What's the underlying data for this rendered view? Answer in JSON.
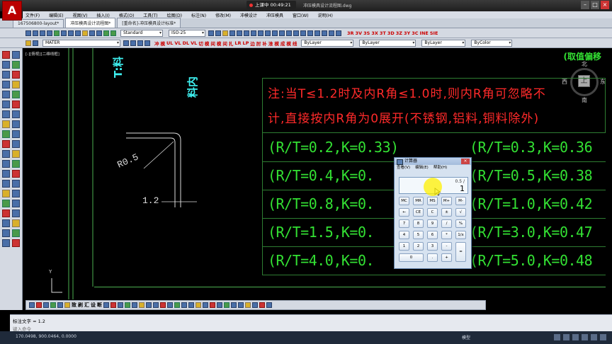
{
  "app": {
    "recording": "上课中 00:49:21",
    "doc_title": "冲压模具设计流程图.dwg"
  },
  "menu": [
    "文件(F)",
    "编辑(E)",
    "视图(V)",
    "插入(I)",
    "格式(O)",
    "工具(T)",
    "绘图(D)",
    "标注(N)",
    "修改(M)",
    "冲模设计",
    "冲压模具",
    "窗口(W)",
    "说明(H)"
  ],
  "tabs": [
    "167506800-layout*",
    "冲压模具设计流程图*",
    "[重命名]-冲压模具设计标准*"
  ],
  "toolbar": {
    "text_style": "Standard",
    "dim_style": "ISO-25",
    "layer": "MATER",
    "color": "ByLayer",
    "linetype": "ByLayer",
    "lineweight": "ByLayer",
    "plotstyle": "ByColor",
    "red_cmds1": [
      "3R",
      "3V",
      "3S",
      "3X",
      "3T",
      "3D",
      "3Z",
      "3Y",
      "3C",
      "INE",
      "SIE"
    ],
    "red_cmds2": [
      "冲",
      "模",
      "UL",
      "VL",
      "DL",
      "VL",
      "切",
      "模",
      "间",
      "模",
      "间",
      "扎",
      "LR",
      "LP",
      "边",
      "肘",
      "补",
      "淮",
      "模",
      "成",
      "模",
      "线"
    ]
  },
  "canvas": {
    "view_label": "[-][俯视][二维线框]",
    "hint": "(取值偏移",
    "left_text1": "T:料",
    "left_text2": "料内",
    "dim_radius": "R0.5",
    "dim_thickness": "1.2",
    "compass": {
      "north": "北",
      "south": "南",
      "east": "东",
      "west": "西",
      "center": "上"
    },
    "note_line1": "注:当T≤1.2时及内R角≤1.0时,则内R角可忽略不",
    "note_line2": "计,直接按内R角为0展开(不锈钢,铝料,铜料除外)",
    "table_left": [
      "(R/T=0.2,K=0.33)",
      "(R/T=0.4,K=0.",
      "(R/T=0.8,K=0.",
      "(R/T=1.5,K=0.",
      "(R/T=4.0,K=0."
    ],
    "table_right": [
      "(R/T=0.3,K=0.36",
      "(R/T=0.5,K=0.38",
      "(R/T=1.0,K=0.42",
      "(R/T=3.0,K=0.47",
      "(R/T=5.0,K=0.48"
    ]
  },
  "calculator": {
    "title": "计算器",
    "menus": [
      "查看(V)",
      "编辑(E)",
      "帮助(H)"
    ],
    "expression": "0.5 /",
    "display": "1",
    "keys": [
      [
        "MC",
        "MR",
        "MS",
        "M+",
        "M-"
      ],
      [
        "←",
        "CE",
        "C",
        "±",
        "√"
      ],
      [
        "7",
        "8",
        "9",
        "/",
        "%"
      ],
      [
        "4",
        "5",
        "6",
        "*",
        "1/x"
      ],
      [
        "1",
        "2",
        "3",
        "-",
        "="
      ],
      [
        "0",
        ".",
        "+"
      ]
    ]
  },
  "bottom_toolbar": [
    "致",
    "刷",
    "汇",
    "设",
    "断"
  ],
  "command": {
    "last": "标注文字 = 1.2",
    "prompt": "键入命令"
  },
  "status": {
    "coords": "170.0498, 900.0464, 0.0000",
    "model": "模型"
  }
}
